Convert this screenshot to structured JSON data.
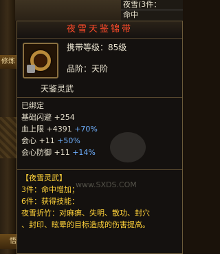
{
  "background": {
    "strip1": "修炼",
    "strip2": "悟"
  },
  "top_right": {
    "line1": "夜雪(3件：",
    "line2": "命中"
  },
  "item": {
    "name": "夜雪天鉴锦带",
    "requirement": "携带等级：85级",
    "grade": "品阶：天阶",
    "subtitle": "天鉴灵武"
  },
  "stats": {
    "bound": "已绑定",
    "dodge": "基础闪避 +254",
    "hp_label": "血上限",
    "hp_value": "+4391",
    "hp_pct": "+70%",
    "crit_label": "会心",
    "crit_value": "+11",
    "crit_pct": "+50%",
    "crit_def_label": "会心防御",
    "crit_def_value": "+11",
    "crit_def_pct": "+14%"
  },
  "set": {
    "name": "【夜雪灵武】",
    "piece3": "3件：命中增加；",
    "piece6": "6件：获得技能：",
    "skill_line1": "夜雪折竹：对麻痹、失明、散功、封穴",
    "skill_line2": "、封印、眩晕的目标造成的伤害提高。"
  },
  "watermark": "www.SXDS.COM"
}
